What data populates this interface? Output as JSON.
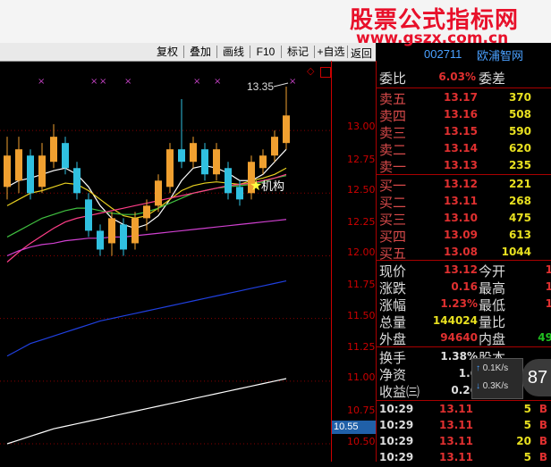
{
  "header": {
    "watermark_title": "股票公式指标网",
    "watermark_url": "www.gszx.com.cn",
    "stock_code": "002711",
    "stock_name": "欧浦智网"
  },
  "toolbar": {
    "items": [
      "复权",
      "叠加",
      "画线",
      "F10",
      "标记",
      "+自选",
      "返回"
    ]
  },
  "chart": {
    "price_labels": [
      "13.00",
      "12.75",
      "12.50",
      "12.25",
      "12.00",
      "11.75",
      "11.50",
      "11.25",
      "11.00",
      "10.75",
      "10.50"
    ],
    "current_tag": "10.55",
    "high_annotation": "13.35",
    "marker_label": "机构"
  },
  "chart_data": {
    "type": "candlestick",
    "ylim": [
      10.5,
      13.4
    ],
    "candles": [
      {
        "o": 12.55,
        "c": 12.8,
        "h": 12.95,
        "l": 12.45
      },
      {
        "o": 12.6,
        "c": 12.85,
        "h": 12.95,
        "l": 12.5
      },
      {
        "o": 12.8,
        "c": 12.5,
        "h": 12.85,
        "l": 12.45
      },
      {
        "o": 12.55,
        "c": 12.8,
        "h": 12.9,
        "l": 12.5
      },
      {
        "o": 12.75,
        "c": 12.95,
        "h": 13.05,
        "l": 12.7
      },
      {
        "o": 12.9,
        "c": 12.7,
        "h": 12.95,
        "l": 12.65
      },
      {
        "o": 12.7,
        "c": 12.5,
        "h": 12.75,
        "l": 12.45
      },
      {
        "o": 12.45,
        "c": 12.2,
        "h": 12.5,
        "l": 12.15
      },
      {
        "o": 12.2,
        "c": 12.05,
        "h": 12.25,
        "l": 12.0
      },
      {
        "o": 12.1,
        "c": 12.3,
        "h": 12.35,
        "l": 12.0
      },
      {
        "o": 12.25,
        "c": 12.05,
        "h": 12.3,
        "l": 12.0
      },
      {
        "o": 12.1,
        "c": 12.3,
        "h": 12.35,
        "l": 12.05
      },
      {
        "o": 12.3,
        "c": 12.4,
        "h": 12.45,
        "l": 12.2
      },
      {
        "o": 12.4,
        "c": 12.6,
        "h": 12.65,
        "l": 12.35
      },
      {
        "o": 12.55,
        "c": 12.85,
        "h": 12.9,
        "l": 12.5
      },
      {
        "o": 12.85,
        "c": 12.75,
        "h": 13.25,
        "l": 12.7
      },
      {
        "o": 12.75,
        "c": 12.9,
        "h": 12.95,
        "l": 12.7
      },
      {
        "o": 12.85,
        "c": 12.65,
        "h": 12.9,
        "l": 12.6
      },
      {
        "o": 12.65,
        "c": 12.85,
        "h": 12.9,
        "l": 12.6
      },
      {
        "o": 12.7,
        "c": 12.5,
        "h": 12.75,
        "l": 12.45
      },
      {
        "o": 12.55,
        "c": 12.45,
        "h": 12.6,
        "l": 12.4
      },
      {
        "o": 12.5,
        "c": 12.75,
        "h": 12.8,
        "l": 12.45
      },
      {
        "o": 12.7,
        "c": 12.8,
        "h": 12.85,
        "l": 12.65
      },
      {
        "o": 12.8,
        "c": 12.95,
        "h": 13.0,
        "l": 12.75
      },
      {
        "o": 12.9,
        "c": 13.12,
        "h": 13.35,
        "l": 12.85
      }
    ],
    "ma_lines": [
      {
        "color": "#ffffff",
        "values": [
          12.55,
          12.6,
          12.62,
          12.65,
          12.68,
          12.7,
          12.65,
          12.55,
          12.4,
          12.3,
          12.25,
          12.22,
          12.25,
          12.32,
          12.45,
          12.6,
          12.7,
          12.72,
          12.7,
          12.66,
          12.6,
          12.6,
          12.65,
          12.75,
          12.85
        ]
      },
      {
        "color": "#e8d020",
        "values": [
          12.4,
          12.45,
          12.5,
          12.52,
          12.55,
          12.58,
          12.57,
          12.52,
          12.45,
          12.38,
          12.32,
          12.3,
          12.32,
          12.38,
          12.45,
          12.52,
          12.56,
          12.58,
          12.59,
          12.58,
          12.57,
          12.6,
          12.62,
          12.65,
          12.7
        ]
      },
      {
        "color": "#40c040",
        "values": [
          12.15,
          12.2,
          12.25,
          12.3,
          12.33,
          12.36,
          12.38,
          12.38,
          12.36,
          12.34,
          12.33,
          12.33,
          12.35,
          12.38,
          12.42,
          12.46,
          12.5,
          12.52,
          12.54,
          12.55,
          12.56,
          12.57,
          12.59,
          12.62,
          12.64
        ]
      },
      {
        "color": "#ff3e88",
        "values": [
          11.95,
          12.03,
          12.1,
          12.16,
          12.22,
          12.27,
          12.3,
          12.32,
          12.34,
          12.36,
          12.38,
          12.4,
          12.42,
          12.44,
          12.46,
          12.48,
          12.5,
          12.52,
          12.54,
          12.56,
          12.57,
          12.58,
          12.6,
          12.62,
          12.65
        ]
      },
      {
        "color": "#d040d0",
        "values": [
          12.0,
          12.04,
          12.07,
          12.09,
          12.1,
          12.12,
          12.13,
          12.14,
          12.14,
          12.15,
          12.15,
          12.16,
          12.17,
          12.18,
          12.19,
          12.2,
          12.21,
          12.22,
          12.23,
          12.24,
          12.25,
          12.26,
          12.27,
          12.28,
          12.29
        ]
      },
      {
        "color": "#2040e0",
        "values": [
          11.2,
          11.25,
          11.3,
          11.33,
          11.36,
          11.39,
          11.42,
          11.45,
          11.48,
          11.5,
          11.52,
          11.54,
          11.56,
          11.58,
          11.6,
          11.62,
          11.64,
          11.66,
          11.68,
          11.7,
          11.72,
          11.74,
          11.76,
          11.78,
          11.8
        ]
      },
      {
        "color": "#ffffff",
        "values": [
          10.5,
          10.53,
          10.56,
          10.59,
          10.62,
          10.64,
          10.66,
          10.68,
          10.7,
          10.72,
          10.74,
          10.76,
          10.78,
          10.8,
          10.82,
          10.84,
          10.86,
          10.88,
          10.9,
          10.92,
          10.94,
          10.96,
          10.98,
          11.0,
          11.02
        ]
      }
    ]
  },
  "quote": {
    "weibi_label": "委比",
    "weibi_value": "6.03%",
    "weicha_label": "委差",
    "asks": [
      {
        "label": "卖五",
        "price": "13.17",
        "vol": "370"
      },
      {
        "label": "卖四",
        "price": "13.16",
        "vol": "508"
      },
      {
        "label": "卖三",
        "price": "13.15",
        "vol": "590"
      },
      {
        "label": "卖二",
        "price": "13.14",
        "vol": "620"
      },
      {
        "label": "卖一",
        "price": "13.13",
        "vol": "235"
      }
    ],
    "bids": [
      {
        "label": "买一",
        "price": "13.12",
        "vol": "221"
      },
      {
        "label": "买二",
        "price": "13.11",
        "vol": "268"
      },
      {
        "label": "买三",
        "price": "13.10",
        "vol": "475"
      },
      {
        "label": "买四",
        "price": "13.09",
        "vol": "613"
      },
      {
        "label": "买五",
        "price": "13.08",
        "vol": "1044"
      }
    ],
    "stats": [
      {
        "label": "现价",
        "value": "13.12",
        "label2": "今开",
        "value2": "1"
      },
      {
        "label": "涨跌",
        "value": "0.16",
        "label2": "最高",
        "value2": "1"
      },
      {
        "label": "涨幅",
        "value": "1.23%",
        "label2": "最低",
        "value2": "1"
      },
      {
        "label": "总量",
        "value": "144024",
        "label2": "量比",
        "value2": ""
      },
      {
        "label": "外盘",
        "value": "94640",
        "label2": "内盘",
        "value2": "49"
      }
    ],
    "stats2": [
      {
        "label": "换手",
        "value": "1.38%",
        "label2": "股本",
        "value2": ""
      },
      {
        "label": "净资",
        "value": "1.6",
        "label2": "",
        "value2": ""
      },
      {
        "label": "收益㈢",
        "value": "0.26",
        "label2": "",
        "value2": ""
      }
    ],
    "net_widget": {
      "up": "0.1K/s",
      "down": "0.3K/s",
      "score": "87"
    },
    "ticks": [
      {
        "time": "10:29",
        "price": "13.11",
        "vol": "5",
        "side": "B"
      },
      {
        "time": "10:29",
        "price": "13.11",
        "vol": "5",
        "side": "B"
      },
      {
        "time": "10:29",
        "price": "13.11",
        "vol": "20",
        "side": "B"
      },
      {
        "time": "10:29",
        "price": "13.11",
        "vol": "5",
        "side": "B"
      }
    ]
  }
}
